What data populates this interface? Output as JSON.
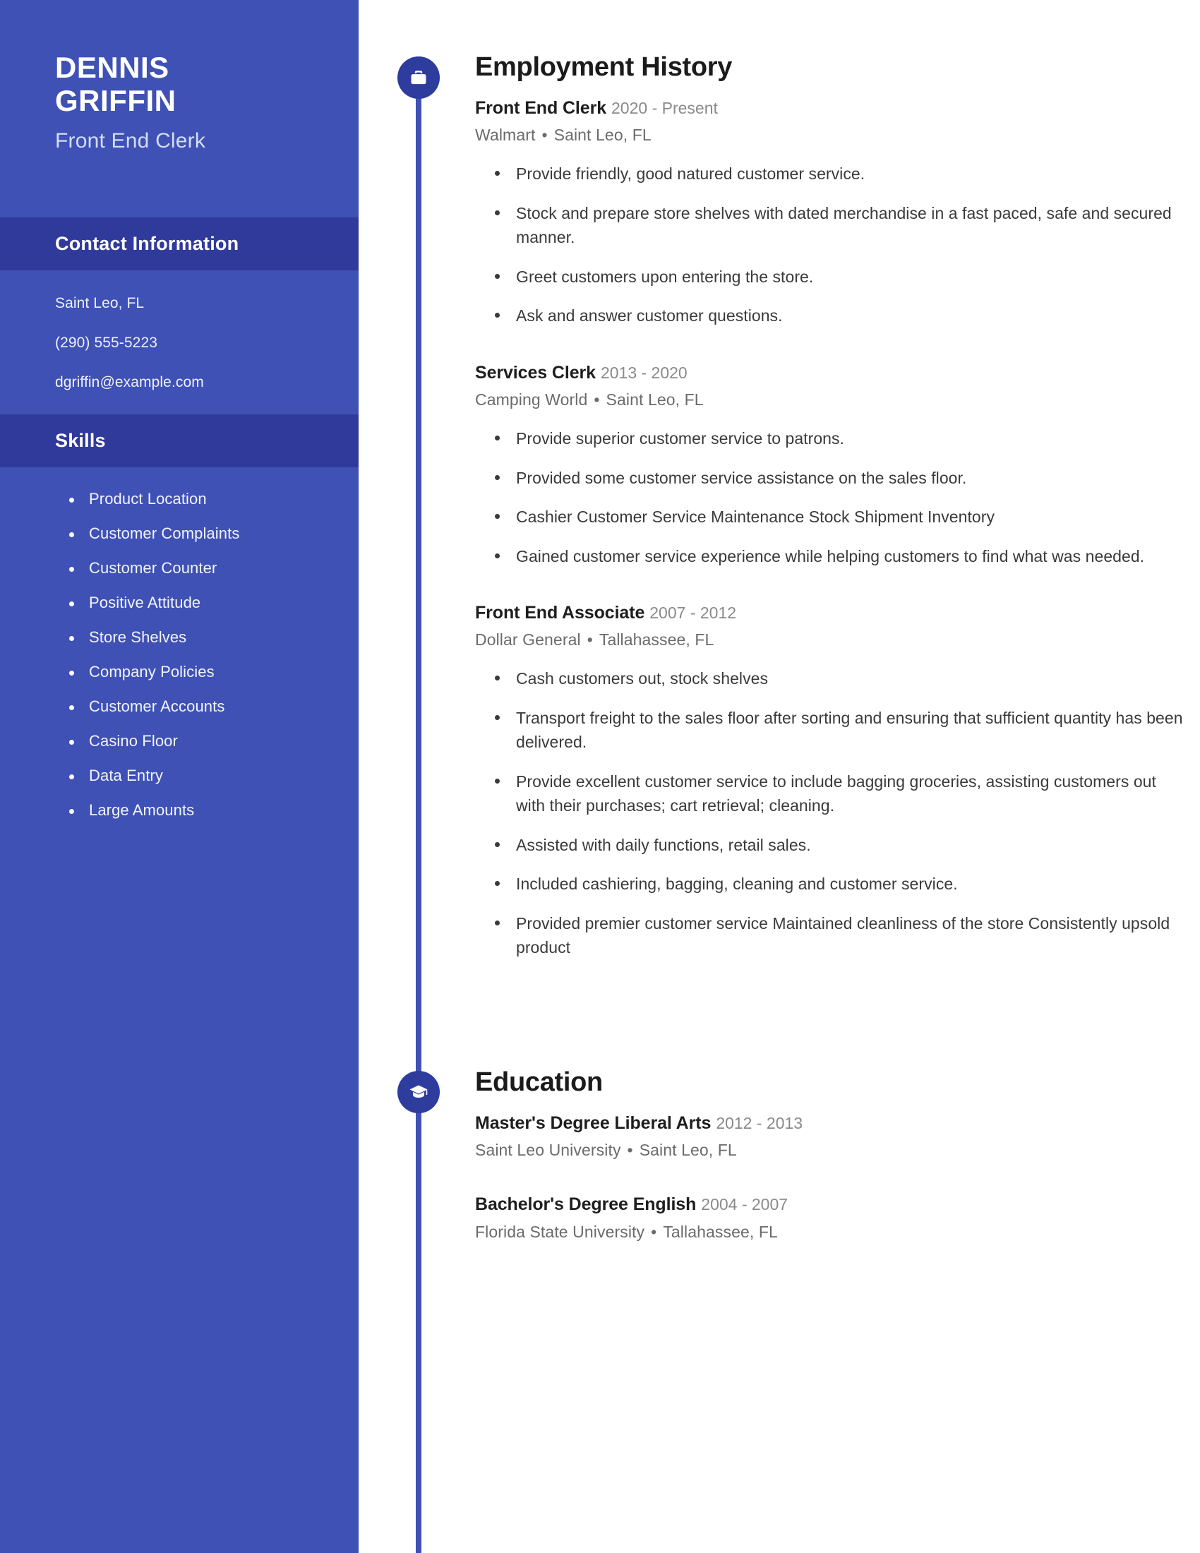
{
  "sidebar": {
    "first_name": "DENNIS",
    "last_name": "GRIFFIN",
    "job_title": "Front End Clerk",
    "contact_heading": "Contact Information",
    "contact_items": [
      "Saint Leo, FL",
      "(290) 555-5223",
      "dgriffin@example.com"
    ],
    "skills_heading": "Skills",
    "skills": [
      "Product Location",
      "Customer Complaints",
      "Customer Counter",
      "Positive Attitude",
      "Store Shelves",
      "Company Policies",
      "Customer Accounts",
      "Casino Floor",
      "Data Entry",
      "Large Amounts"
    ]
  },
  "employment": {
    "heading": "Employment History",
    "icon": "briefcase-icon",
    "entries": [
      {
        "role": "Front End Clerk",
        "dates": "2020 - Present",
        "company": "Walmart",
        "location": "Saint Leo, FL",
        "duties": [
          "Provide friendly, good natured customer service.",
          "Stock and prepare store shelves with dated merchandise in a fast paced, safe and secured manner.",
          "Greet customers upon entering the store.",
          "Ask and answer customer questions."
        ]
      },
      {
        "role": "Services Clerk",
        "dates": "2013 - 2020",
        "company": "Camping World",
        "location": "Saint Leo, FL",
        "duties": [
          "Provide superior customer service to patrons.",
          "Provided some customer service assistance on the sales floor.",
          "Cashier Customer Service Maintenance Stock Shipment Inventory",
          "Gained customer service experience while helping customers to find what was needed."
        ]
      },
      {
        "role": "Front End Associate",
        "dates": "2007 - 2012",
        "company": "Dollar General",
        "location": "Tallahassee, FL",
        "duties": [
          "Cash customers out, stock shelves",
          "Transport freight to the sales floor after sorting and ensuring that sufficient quantity has been delivered.",
          "Provide excellent customer service to include bagging groceries, assisting customers out with their purchases; cart retrieval; cleaning.",
          "Assisted with daily functions, retail sales.",
          "Included cashiering, bagging, cleaning and customer service.",
          "Provided premier customer service Maintained cleanliness of the store Consistently upsold product"
        ]
      }
    ]
  },
  "education": {
    "heading": "Education",
    "icon": "graduation-cap-icon",
    "entries": [
      {
        "degree": "Master's Degree Liberal Arts",
        "dates": "2012 - 2013",
        "school": "Saint Leo University",
        "location": "Saint Leo, FL"
      },
      {
        "degree": "Bachelor's Degree English",
        "dates": "2004 - 2007",
        "school": "Florida State University",
        "location": "Tallahassee, FL"
      }
    ]
  },
  "separator": "•",
  "colors": {
    "sidebar_blue": "#3f51b5",
    "sidebar_bar_dark": "#303a9b",
    "accent_dot": "#2e3c9e",
    "body_text": "#3a3a3a",
    "muted_text": "#8a8a8a"
  }
}
